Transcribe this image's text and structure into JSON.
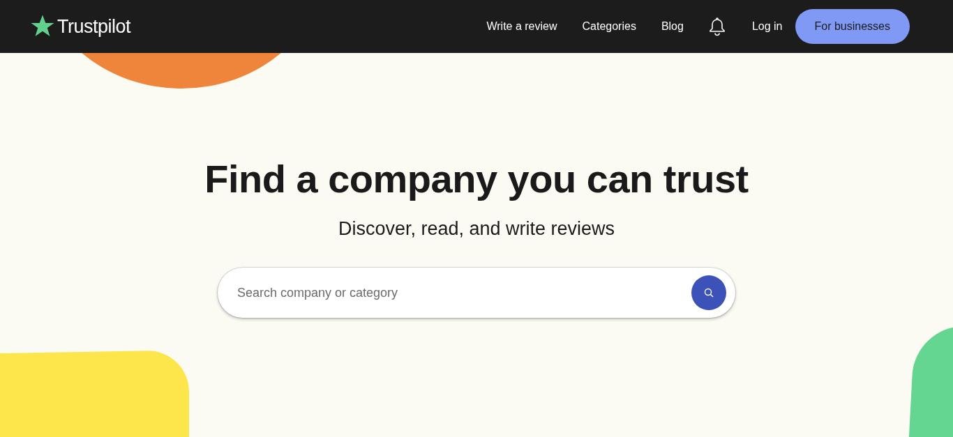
{
  "header": {
    "logo": "Trustpilot",
    "nav": [
      {
        "kind": "link",
        "label": "Write a review"
      },
      {
        "kind": "link",
        "label": "Categories"
      },
      {
        "kind": "link",
        "label": "Blog"
      },
      {
        "kind": "bell"
      },
      {
        "kind": "link",
        "label": "Log in"
      },
      {
        "kind": "button",
        "label": "For businesses"
      }
    ]
  },
  "hero": {
    "title": "Find a company you can trust",
    "subtitle": "Discover, read, and write reviews",
    "search": {
      "placeholder": "Search company or category"
    }
  }
}
